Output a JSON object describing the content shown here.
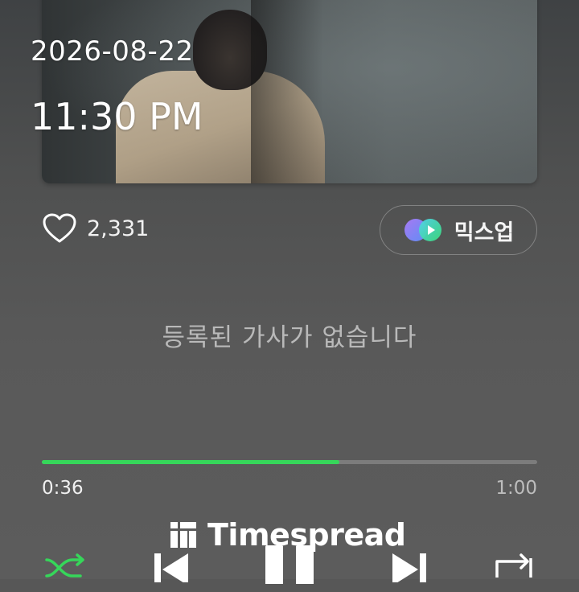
{
  "overlay": {
    "date": "2026-08-22",
    "time": "11:30 PM"
  },
  "like": {
    "count": "2,331"
  },
  "mixup": {
    "label": "믹스업"
  },
  "lyrics": {
    "message": "등록된 가사가 없습니다"
  },
  "player": {
    "elapsed": "0:36",
    "duration": "1:00",
    "progress": 0.6
  },
  "watermark": {
    "text": "Timespread"
  },
  "colors": {
    "accent": "#36d65a"
  },
  "controls": [
    "shuffle-icon",
    "previous-icon",
    "pause-icon",
    "next-icon",
    "repeat-icon"
  ]
}
